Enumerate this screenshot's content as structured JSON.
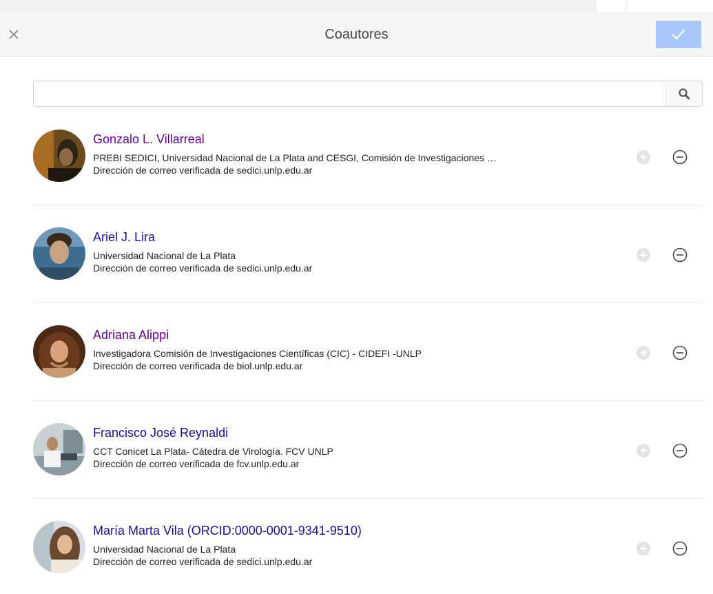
{
  "dialog": {
    "title": "Coautores",
    "close_icon": "close-icon",
    "done_icon": "checkmark-icon"
  },
  "search": {
    "value": "",
    "placeholder": "",
    "icon": "search-icon"
  },
  "colors": {
    "link": "#1a0dab",
    "visited_link": "#660099",
    "done_button": "#a8c7fa",
    "header_bg": "#f5f5f5"
  },
  "coauthors": [
    {
      "name": "Gonzalo L. Villarreal",
      "affiliation": "PREBI SEDICI, Universidad Nacional de La Plata and CESGI, Comisión de Investigaciones …",
      "email": "Dirección de correo verificada de sedici.unlp.edu.ar",
      "avatar_icon": "avatar-photo",
      "visited": true
    },
    {
      "name": "Ariel J. Lira",
      "affiliation": "Universidad Nacional de La Plata",
      "email": "Dirección de correo verificada de sedici.unlp.edu.ar",
      "avatar_icon": "avatar-photo",
      "visited": false
    },
    {
      "name": "Adriana Alippi",
      "affiliation": "Investigadora Comisión de Investigaciones Científicas (CIC) - CIDEFI -UNLP",
      "email": "Dirección de correo verificada de biol.unlp.edu.ar",
      "avatar_icon": "avatar-photo",
      "visited": true
    },
    {
      "name": "Francisco José Reynaldi",
      "affiliation": "CCT Conicet La Plata- Cátedra de Virología. FCV UNLP",
      "email": "Dirección de correo verificada de fcv.unlp.edu.ar",
      "avatar_icon": "avatar-photo",
      "visited": false
    },
    {
      "name": "María Marta Vila (ORCID:0000-0001-9341-9510)",
      "affiliation": "Universidad Nacional de La Plata",
      "email": "Dirección de correo verificada de sedici.unlp.edu.ar",
      "avatar_icon": "avatar-photo",
      "visited": false
    }
  ]
}
